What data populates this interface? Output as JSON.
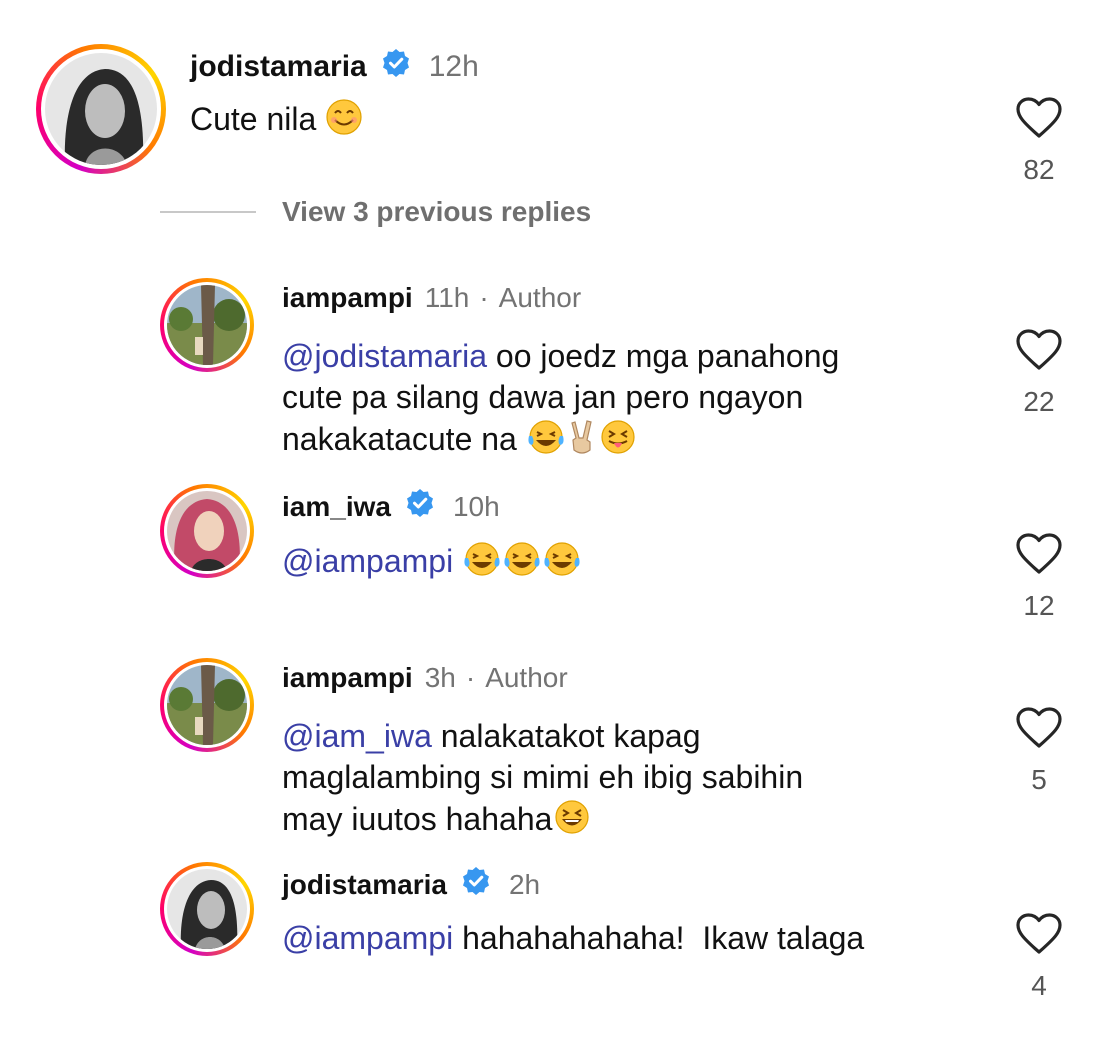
{
  "comments": [
    {
      "username": "jodistamaria",
      "verified": true,
      "time": "12h",
      "author_tag": "",
      "mention": "",
      "text": "Cute nila",
      "likes": "82",
      "avatar": "portrait-bw"
    },
    {
      "username": "iampampi",
      "verified": false,
      "time": "11h",
      "author_tag": "Author",
      "mention": "@jodistamaria",
      "text_lines": [
        "oo joedz mga panahong",
        "cute pa silang dawa jan pero ngayon",
        "nakakatacute na"
      ],
      "likes": "22",
      "avatar": "tree-park"
    },
    {
      "username": "iam_iwa",
      "verified": true,
      "time": "10h",
      "author_tag": "",
      "mention": "@iampampi",
      "text": "",
      "likes": "12",
      "avatar": "portrait-pink-hair"
    },
    {
      "username": "iampampi",
      "verified": false,
      "time": "3h",
      "author_tag": "Author",
      "mention": "@iam_iwa",
      "text_lines": [
        "nalakatakot kapag",
        "maglalambing si mimi eh ibig sabihin",
        "may iuutos hahaha"
      ],
      "likes": "5",
      "avatar": "tree-park"
    },
    {
      "username": "jodistamaria",
      "verified": true,
      "time": "2h",
      "author_tag": "",
      "mention": "@iampampi",
      "text": "hahahahahaha!  Ikaw talaga",
      "likes": "4",
      "avatar": "portrait-bw"
    }
  ],
  "view_replies": "View 3 previous replies",
  "separator_dot": "·",
  "colors": {
    "mention": "#3a3fa6",
    "verified": "#3797f0",
    "secondary_text": "#737373"
  },
  "icons": {
    "like": "heart-outline-icon",
    "verified": "verified-badge-icon"
  }
}
